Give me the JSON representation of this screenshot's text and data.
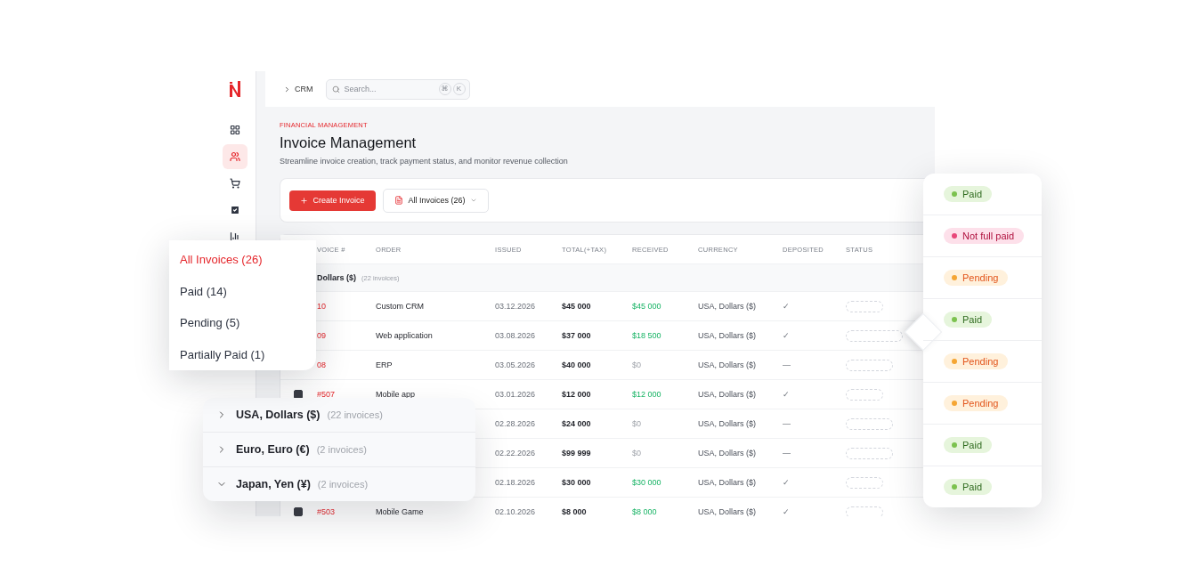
{
  "sidebar": {
    "items": [
      {
        "kind": "dashboard",
        "selected": false
      },
      {
        "kind": "customers",
        "selected": true
      },
      {
        "kind": "orders",
        "selected": false
      },
      {
        "kind": "tasks",
        "selected": false
      },
      {
        "kind": "reports",
        "selected": false
      }
    ]
  },
  "topbar": {
    "breadcrumb": "CRM",
    "search": {
      "placeholder": "Search...",
      "keys": [
        "⌘",
        "K"
      ]
    }
  },
  "header": {
    "eyebrow": "FINANCIAL MANAGEMENT",
    "title": "Invoice Management",
    "subtitle": "Streamline invoice creation, track payment status, and monitor revenue collection"
  },
  "toolbar": {
    "create_button": "Create Invoice",
    "filter_button": "All Invoices (26)"
  },
  "table": {
    "columns": [
      "VOICE #",
      "ORDER",
      "ISSUED",
      "TOTAL(+TAX)",
      "RECEIVED",
      "CURRENCY",
      "DEPOSITED",
      "STATUS"
    ],
    "group": {
      "name": "Dollars ($)",
      "count": "(22 invoices)"
    },
    "rows": [
      {
        "invoice": "10",
        "order": "Custom CRM",
        "issued": "03.12.2026",
        "total": "$45 000",
        "received": "$45 000",
        "paid": true,
        "currency": "USA, Dollars ($)",
        "deposited": "✓"
      },
      {
        "invoice": "09",
        "order": "Web application",
        "issued": "03.08.2026",
        "total": "$37 000",
        "received": "$18 500",
        "paid": true,
        "currency": "USA, Dollars ($)",
        "deposited": "✓"
      },
      {
        "invoice": "08",
        "order": "ERP",
        "issued": "03.05.2026",
        "total": "$40 000",
        "received": "$0",
        "paid": false,
        "currency": "USA, Dollars ($)",
        "deposited": "—"
      },
      {
        "checked": true,
        "invoice": "#507",
        "order": "Mobile app",
        "issued": "03.01.2026",
        "total": "$12 000",
        "received": "$12 000",
        "paid": true,
        "currency": "USA, Dollars ($)",
        "deposited": "✓"
      },
      {
        "issued": "02.28.2026",
        "total": "$24 000",
        "received": "$0",
        "paid": false,
        "currency": "USA, Dollars ($)",
        "deposited": "—"
      },
      {
        "issued": "02.22.2026",
        "total": "$99 999",
        "received": "$0",
        "paid": false,
        "currency": "USA, Dollars ($)",
        "deposited": "—"
      },
      {
        "issued": "02.18.2026",
        "total": "$30 000",
        "received": "$30 000",
        "paid": true,
        "currency": "USA, Dollars ($)",
        "deposited": "✓"
      },
      {
        "checked": true,
        "invoice": "#503",
        "order": "Mobile Game",
        "issued": "02.10.2026",
        "total": "$8 000",
        "received": "$8 000",
        "paid": true,
        "currency": "USA, Dollars ($)",
        "deposited": "✓"
      }
    ]
  },
  "filter_menu": {
    "items": [
      {
        "label": "All Invoices (26)",
        "selected": true
      },
      {
        "label": "Paid (14)",
        "selected": false
      },
      {
        "label": "Pending (5)",
        "selected": false
      },
      {
        "label": "Partially Paid (1)",
        "selected": false
      }
    ]
  },
  "currency_groups": [
    {
      "name": "USA, Dollars ($)",
      "count": "(22 invoices)",
      "expanded": false
    },
    {
      "name": "Euro, Euro (€)",
      "count": "(2 invoices)",
      "expanded": false
    },
    {
      "name": "Japan, Yen (¥)",
      "count": "(2 invoices)",
      "expanded": true
    }
  ],
  "statuses": [
    {
      "label": "Paid",
      "kind": "paid"
    },
    {
      "label": "Not full paid",
      "kind": "partial"
    },
    {
      "label": "Pending",
      "kind": "pending"
    },
    {
      "label": "Paid",
      "kind": "paid"
    },
    {
      "label": "Pending",
      "kind": "pending"
    },
    {
      "label": "Pending",
      "kind": "pending"
    },
    {
      "label": "Paid",
      "kind": "paid"
    },
    {
      "label": "Paid",
      "kind": "paid"
    }
  ]
}
